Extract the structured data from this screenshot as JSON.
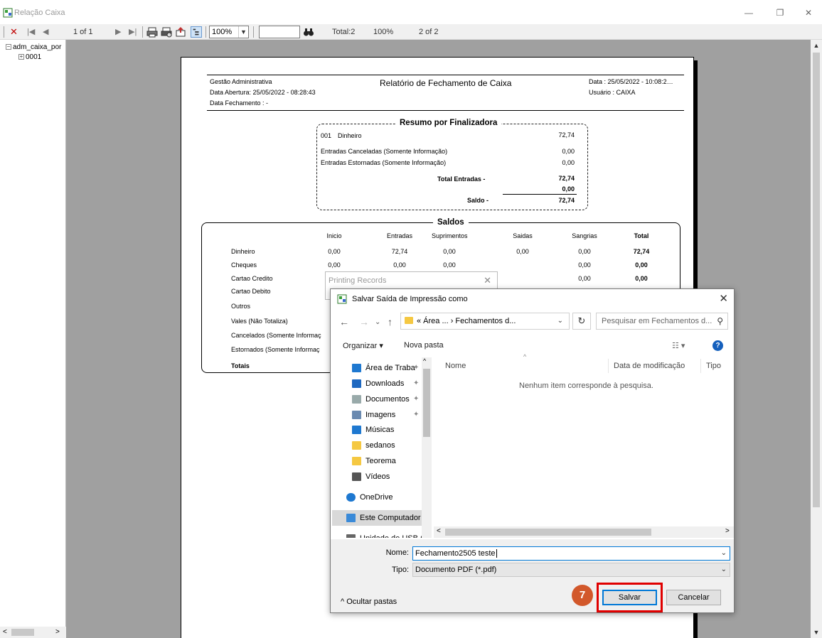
{
  "window": {
    "title": "Relação Caixa",
    "minimize": "—",
    "restore": "❐",
    "close": "✕"
  },
  "toolbar": {
    "page_of": "1 of 1",
    "zoom": "100%",
    "find_value": "",
    "total": "Total:2",
    "zoom_readout": "100%",
    "pages": "2 of 2"
  },
  "tree": {
    "root": "adm_caixa_por",
    "child": "0001"
  },
  "report": {
    "company": "Gestão Administrativa",
    "title": "Relatório de Fechamento de Caixa",
    "date_line": "Data : 25/05/2022 - 10:08:2…",
    "user_line": "Usuário : CAIXA",
    "opening": "Data Abertura: 25/05/2022 - 08:28:43",
    "closing": "Data Fechamento :  -",
    "resumo": {
      "heading": "Resumo por Finalizadora",
      "code": "001",
      "name": "Dinheiro",
      "value": "72,74",
      "canceladas_label": "Entradas Canceladas (Somente Informação)",
      "canceladas_value": "0,00",
      "estornadas_label": "Entradas Estornadas (Somente Informação)",
      "estornadas_value": "0,00",
      "total_label": "Total Entradas  -",
      "total_value": "72,74",
      "zero_value": "0,00",
      "saldo_label": "Saldo  -",
      "saldo_value": "72,74"
    },
    "saldos": {
      "heading": "Saldos",
      "columns": [
        "Inicio",
        "Entradas",
        "Suprimentos",
        "Saidas",
        "Sangrias",
        "Total"
      ],
      "rows": [
        {
          "label": "Dinheiro",
          "inicio": "0,00",
          "entradas": "72,74",
          "suprimentos": "0,00",
          "saidas": "0,00",
          "sangrias": "0,00",
          "total": "72,74"
        },
        {
          "label": "Cheques",
          "inicio": "0,00",
          "entradas": "0,00",
          "suprimentos": "0,00",
          "sangrias": "0,00",
          "total": "0,00"
        },
        {
          "label": "Cartao Credito",
          "sangrias": "0,00",
          "total": "0,00"
        },
        {
          "label": "Cartao Debito"
        },
        {
          "label": "Outros"
        },
        {
          "label": "Vales (Não Totaliza)"
        },
        {
          "label": "Cancelados (Somente Informaç"
        },
        {
          "label": "Estornados (Somente Informaç"
        },
        {
          "label": "Totais"
        }
      ]
    }
  },
  "printing_dialog": {
    "title": "Printing Records",
    "close": "✕"
  },
  "save_dialog": {
    "title": "Salvar Saída de Impressão como",
    "close": "✕",
    "breadcrumb": "«  Área ...  ›  Fechamentos d...",
    "search_placeholder": "Pesquisar em Fechamentos d...",
    "organize": "Organizar  ▾",
    "new_folder": "Nova pasta",
    "nav_items": [
      {
        "label": "Área de Traba",
        "icon": "desktop-icon",
        "pinned": true
      },
      {
        "label": "Downloads",
        "icon": "download-icon",
        "pinned": true
      },
      {
        "label": "Documentos",
        "icon": "document-icon",
        "pinned": true
      },
      {
        "label": "Imagens",
        "icon": "image-icon",
        "pinned": true
      },
      {
        "label": "Músicas",
        "icon": "music-icon",
        "pinned": false
      },
      {
        "label": "sedanos",
        "icon": "folder-icon",
        "pinned": false
      },
      {
        "label": "Teorema",
        "icon": "folder-icon",
        "pinned": false
      },
      {
        "label": "Vídeos",
        "icon": "video-icon",
        "pinned": false
      },
      {
        "label": "OneDrive",
        "icon": "cloud-icon",
        "pinned": false
      },
      {
        "label": "Este Computador",
        "icon": "computer-icon",
        "pinned": false,
        "selected": true
      },
      {
        "label": "Unidade de USB (I",
        "icon": "usb-drive-icon",
        "pinned": false
      }
    ],
    "columns": {
      "name": "Nome",
      "modified": "Data de modificação",
      "type": "Tipo"
    },
    "empty_message": "Nenhum item corresponde à pesquisa.",
    "name_label": "Nome:",
    "name_value": "Fechamento2505 teste",
    "type_label": "Tipo:",
    "type_value": "Documento PDF (*.pdf)",
    "hide_folders": "Ocultar pastas",
    "save": "Salvar",
    "cancel": "Cancelar"
  },
  "annotation": {
    "step": "7",
    "highlight_color": "#e00000",
    "badge_color": "#d2582b"
  }
}
